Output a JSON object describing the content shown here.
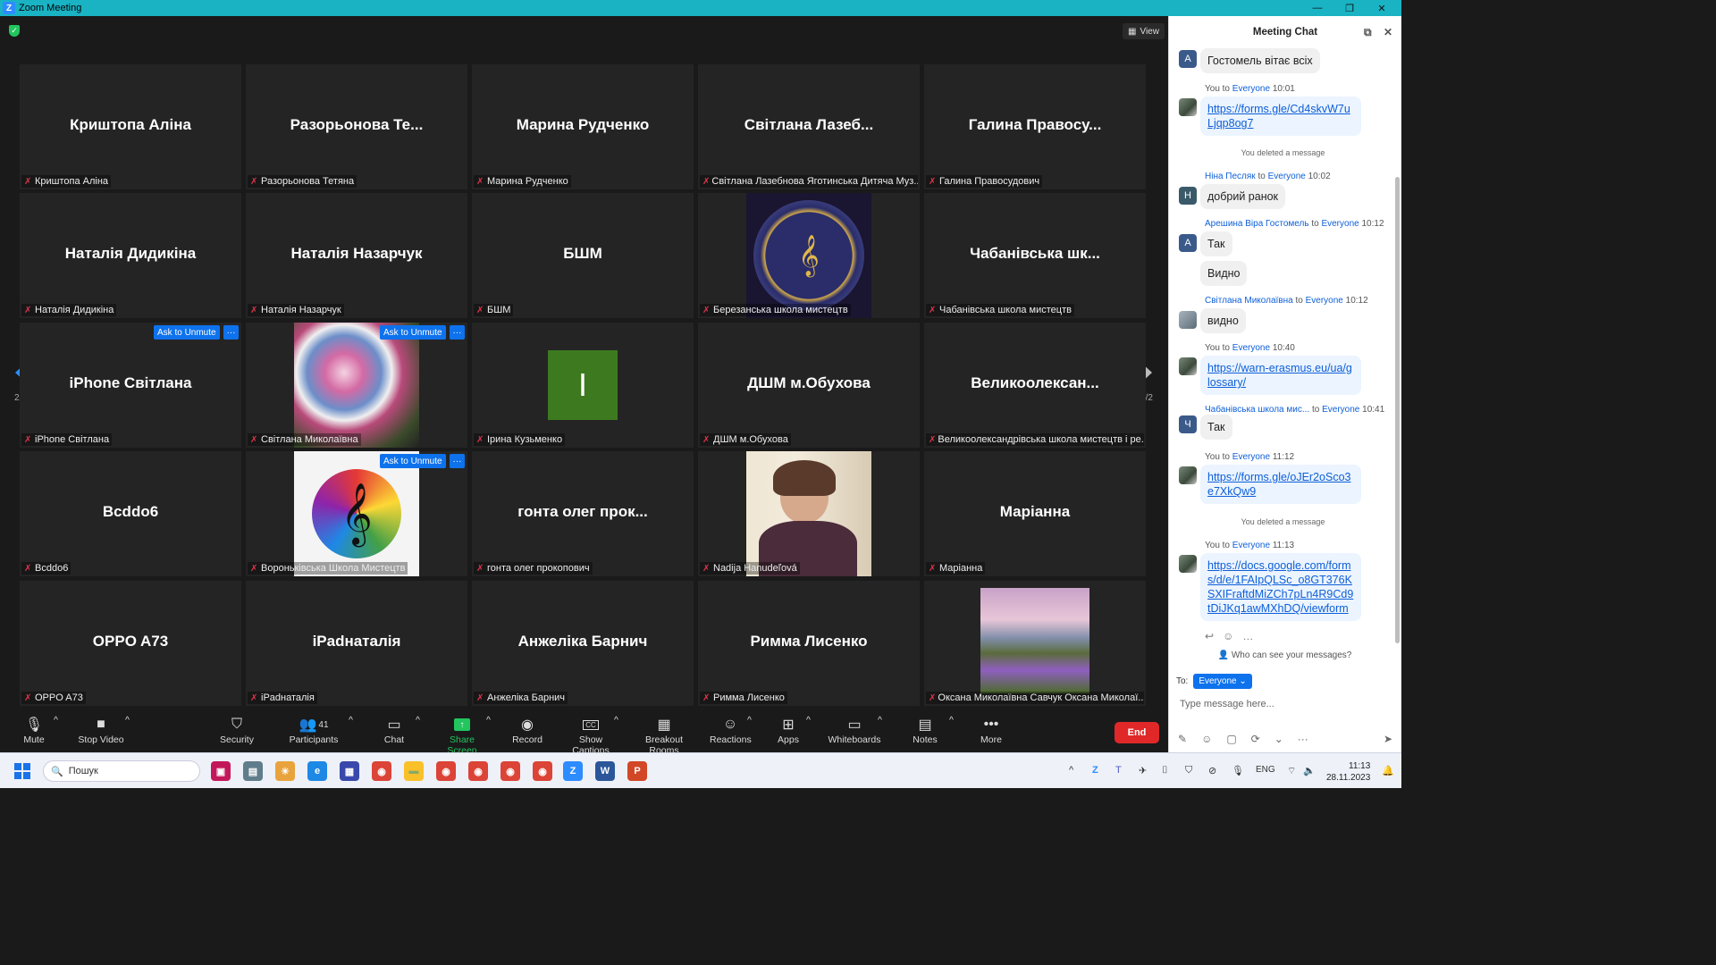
{
  "window": {
    "title": "Zoom Meeting"
  },
  "view_label": "View",
  "tiles": [
    {
      "big": "Криштопа Аліна",
      "label": "Криштопа Аліна"
    },
    {
      "big": "Разорьонова  Те...",
      "label": "Разорьонова Тетяна"
    },
    {
      "big": "Марина Рудченко",
      "label": "Марина Рудченко"
    },
    {
      "big": "Світлана  Лазеб...",
      "label": "Світлана Лазебнова Яготинська Дитяча Муз..."
    },
    {
      "big": "Галина  Правосу...",
      "label": "Галина Правосудович"
    },
    {
      "big": "Наталія Дидикіна",
      "label": "Наталія Дидикіна"
    },
    {
      "big": "Наталія Назарчук",
      "label": "Наталія Назарчук"
    },
    {
      "big": "БШМ",
      "label": "БШМ"
    },
    {
      "big": "",
      "label": "Березанська школа мистецтв",
      "logo_text": "БЕРЕЗАНСЬКА ШКОЛА МИСТЕЦТВ ВИХОВАННЯ КРАСОЮ"
    },
    {
      "big": "Чабанівська  шк...",
      "label": "Чабанівська школа мистецтв"
    },
    {
      "big": "iPhone Світлана",
      "label": "iPhone Світлана"
    },
    {
      "big": "",
      "label": "Світлана Миколаївна"
    },
    {
      "big": "",
      "label": "Ірина Кузьменко",
      "initial": "I"
    },
    {
      "big": "ДШМ м.Обухова",
      "label": "ДШМ м.Обухова"
    },
    {
      "big": "Великоолексан...",
      "label": "Великоолександрівська школа мистецтв і ре..."
    },
    {
      "big": "Bcddo6",
      "label": "Bcddo6"
    },
    {
      "big": "",
      "label": "Вороньківська Школа Мистецтв"
    },
    {
      "big": "гонта  олег  прок...",
      "label": "гонта олег прокопович"
    },
    {
      "big": "",
      "label": "Nadija Hanudeľová"
    },
    {
      "big": "Маріанна",
      "label": "Маріанна"
    },
    {
      "big": "OPPO A73",
      "label": "OPPO A73"
    },
    {
      "big": "iPadнаталія",
      "label": "iPadнаталія"
    },
    {
      "big": "Анжеліка Барнич",
      "label": "Анжеліка Барнич"
    },
    {
      "big": "Римма Лисенко",
      "label": "Римма Лисенко"
    },
    {
      "big": "",
      "label": "Оксана Миколаївна Савчук Оксана Миколаї..."
    }
  ],
  "ask_unmute": "Ask to Unmute",
  "page_indicator": "2/2",
  "toolbar": {
    "mute": "Mute",
    "stop_video": "Stop Video",
    "security": "Security",
    "participants": "Participants",
    "participants_count": "41",
    "chat": "Chat",
    "share": "Share Screen",
    "record": "Record",
    "captions": "Show Captions",
    "captions_icon": "CC",
    "breakout": "Breakout Rooms",
    "reactions": "Reactions",
    "apps": "Apps",
    "whiteboards": "Whiteboards",
    "notes": "Notes",
    "more": "More",
    "end": "End"
  },
  "chat": {
    "title": "Meeting Chat",
    "msg1": {
      "avatar": "А",
      "text": "Гостомель вітає всіх"
    },
    "msg2": {
      "from": "You",
      "to_word": "to",
      "to": "Everyone",
      "time": "10:01",
      "text": "https://forms.gle/Cd4skvW7uLjqp8og7"
    },
    "deleted": "You deleted a message",
    "msg3": {
      "from": "Ніна Песляк",
      "to_word": "to",
      "to": "Everyone",
      "time": "10:02",
      "avatar": "Н",
      "text": "добрий ранок"
    },
    "msg4": {
      "from": "Арешина Віра Гостомель",
      "to_word": "to",
      "to": "Everyone",
      "time": "10:12",
      "avatar": "А",
      "text1": "Так",
      "text2": "Видно"
    },
    "msg5": {
      "from": "Світлана Миколаївна",
      "to_word": "to",
      "to": "Everyone",
      "time": "10:12",
      "text": "видно"
    },
    "msg6": {
      "from": "You",
      "to_word": "to",
      "to": "Everyone",
      "time": "10:40",
      "text": "https://warn-erasmus.eu/ua/glossary/"
    },
    "msg7": {
      "from": "Чабанівська школа мис...",
      "to_word": "to",
      "to": "Everyone",
      "time": "10:41",
      "avatar": "Ч",
      "text": "Так"
    },
    "msg8": {
      "from": "You",
      "to_word": "to",
      "to": "Everyone",
      "time": "11:12",
      "text": "https://forms.gle/oJEr2oSco3e7XkQw9"
    },
    "deleted2": "You deleted a message",
    "msg9": {
      "from": "You",
      "to_word": "to",
      "to": "Everyone",
      "time": "11:13",
      "text": "https://docs.google.com/forms/d/e/1FAIpQLSc_o8GT376KSXIFraftdMiZCh7pLn4R9Cd9tDiJKq1awMXhDQ/viewform"
    },
    "who_can_see": "Who can see your messages?",
    "to_label": "To:",
    "to_value": "Everyone",
    "placeholder": "Type message here..."
  },
  "taskbar": {
    "search": "Пошук",
    "lang": "ENG",
    "time": "11:13",
    "date": "28.11.2023"
  },
  "colors": {
    "accent": "#0e72ed",
    "end": "#e02828",
    "titlebar": "#19b3c4"
  }
}
